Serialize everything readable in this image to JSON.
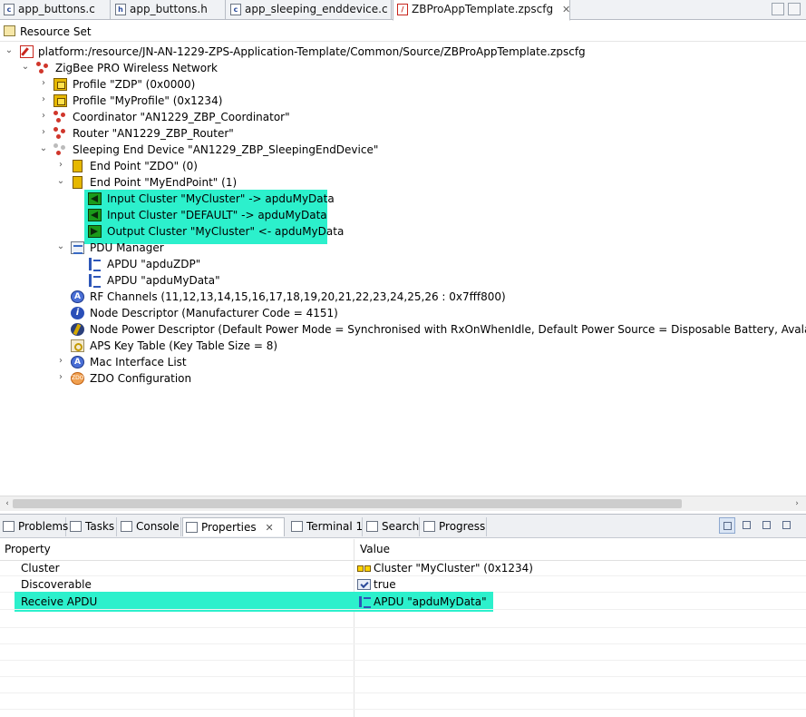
{
  "editor_tabs": [
    {
      "label": "app_buttons.c",
      "icon": "c-file-icon"
    },
    {
      "label": "app_buttons.h",
      "icon": "h-file-icon"
    },
    {
      "label": "app_sleeping_enddevice.c",
      "icon": "c-file-icon"
    },
    {
      "label": "ZBProAppTemplate.zpscfg",
      "icon": "zpscfg-file-icon",
      "active": true
    }
  ],
  "resource_set": {
    "label": "Resource Set"
  },
  "tree": {
    "root": "platform:/resource/JN-AN-1229-ZPS-Application-Template/Common/Source/ZBProAppTemplate.zpscfg",
    "network": "ZigBee PRO Wireless Network",
    "profile_zdp": "Profile \"ZDP\" (0x0000)",
    "profile_my": "Profile \"MyProfile\" (0x1234)",
    "coordinator": "Coordinator \"AN1229_ZBP_Coordinator\"",
    "router": "Router \"AN1229_ZBP_Router\"",
    "sleeping": "Sleeping End Device \"AN1229_ZBP_SleepingEndDevice\"",
    "ep_zdo": "End Point \"ZDO\" (0)",
    "ep_my": "End Point \"MyEndPoint\" (1)",
    "in_cluster_my": "Input Cluster \"MyCluster\" -> apduMyData",
    "in_cluster_default": "Input Cluster \"DEFAULT\" -> apduMyData",
    "out_cluster_my": "Output Cluster \"MyCluster\" <- apduMyData",
    "pdu_manager": "PDU Manager",
    "apdu_zdp": "APDU \"apduZDP\"",
    "apdu_my": "APDU \"apduMyData\"",
    "rf_channels": "RF Channels (11,12,13,14,15,16,17,18,19,20,21,22,23,24,25,26 : 0x7fff800)",
    "node_desc": "Node Descriptor (Manufacturer Code = 4151)",
    "node_power": "Node Power Descriptor (Default Power Mode = Synchronised with RxOnWhenIdle, Default Power Source = Disposable Battery, Avalaible Power Sources = Disposable Battery)",
    "aps_key": "APS Key Table (Key Table Size = 8)",
    "mac_if": "Mac Interface List",
    "zdo_config": "ZDO Configuration"
  },
  "view_tabs": [
    "Problems",
    "Tasks",
    "Console",
    "Properties",
    "Terminal 1",
    "Search",
    "Progress"
  ],
  "properties": {
    "header_property": "Property",
    "header_value": "Value",
    "rows": [
      {
        "name": "Cluster",
        "value": "Cluster \"MyCluster\" (0x1234)",
        "icon": "cluster-icon"
      },
      {
        "name": "Discoverable",
        "value": "true",
        "icon": "boolean-icon"
      },
      {
        "name": "Receive APDU",
        "value": "APDU \"apduMyData\"",
        "icon": "apdu-icon"
      }
    ]
  },
  "colors": {
    "highlight": "#2cf0cc"
  }
}
